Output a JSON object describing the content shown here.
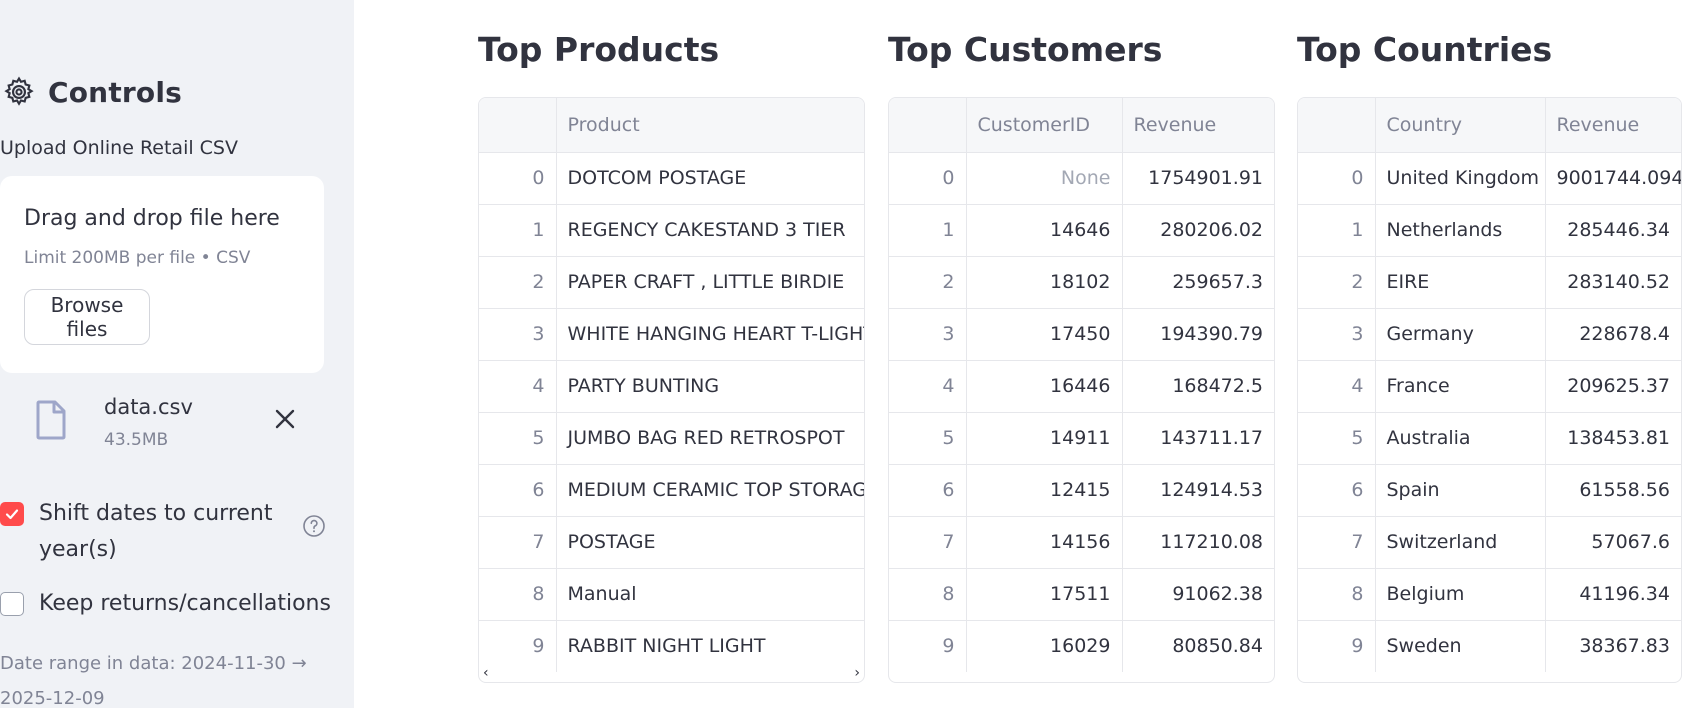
{
  "sidebar": {
    "title": "Controls",
    "upload_label": "Upload Online Retail CSV",
    "dropzone": {
      "title": "Drag and drop file here",
      "limit": "Limit 200MB per file • CSV",
      "browse_label": "Browse files"
    },
    "file": {
      "name": "data.csv",
      "size": "43.5MB"
    },
    "shift_dates": {
      "label": "Shift dates to current year(s)",
      "checked": true
    },
    "keep_returns": {
      "label": "Keep returns/cancellations",
      "checked": false
    },
    "date_range": "Date range in data: 2024-11-30 → 2025-12-09"
  },
  "colors": {
    "accent": "#ff4b4b",
    "sidebar_bg": "#f0f2f6"
  },
  "products": {
    "title": "Top Products",
    "columns": [
      "",
      "Product"
    ],
    "rows": [
      [
        "0",
        "DOTCOM POSTAGE"
      ],
      [
        "1",
        "REGENCY CAKESTAND 3 TIER"
      ],
      [
        "2",
        "PAPER CRAFT , LITTLE BIRDIE"
      ],
      [
        "3",
        "WHITE HANGING HEART T-LIGHT H"
      ],
      [
        "4",
        "PARTY BUNTING"
      ],
      [
        "5",
        "JUMBO BAG RED RETROSPOT"
      ],
      [
        "6",
        "MEDIUM CERAMIC TOP STORAGE J"
      ],
      [
        "7",
        "POSTAGE"
      ],
      [
        "8",
        "Manual"
      ],
      [
        "9",
        "RABBIT NIGHT LIGHT"
      ]
    ],
    "scroll_left": "‹",
    "scroll_right": "›"
  },
  "customers": {
    "title": "Top Customers",
    "columns": [
      "",
      "CustomerID",
      "Revenue"
    ],
    "rows": [
      [
        "0",
        "None",
        "1754901.91"
      ],
      [
        "1",
        "14646",
        "280206.02"
      ],
      [
        "2",
        "18102",
        "259657.3"
      ],
      [
        "3",
        "17450",
        "194390.79"
      ],
      [
        "4",
        "16446",
        "168472.5"
      ],
      [
        "5",
        "14911",
        "143711.17"
      ],
      [
        "6",
        "12415",
        "124914.53"
      ],
      [
        "7",
        "14156",
        "117210.08"
      ],
      [
        "8",
        "17511",
        "91062.38"
      ],
      [
        "9",
        "16029",
        "80850.84"
      ]
    ]
  },
  "countries": {
    "title": "Top Countries",
    "columns": [
      "",
      "Country",
      "Revenue"
    ],
    "rows": [
      [
        "0",
        "United Kingdom",
        "9001744.094"
      ],
      [
        "1",
        "Netherlands",
        "285446.34"
      ],
      [
        "2",
        "EIRE",
        "283140.52"
      ],
      [
        "3",
        "Germany",
        "228678.4"
      ],
      [
        "4",
        "France",
        "209625.37"
      ],
      [
        "5",
        "Australia",
        "138453.81"
      ],
      [
        "6",
        "Spain",
        "61558.56"
      ],
      [
        "7",
        "Switzerland",
        "57067.6"
      ],
      [
        "8",
        "Belgium",
        "41196.34"
      ],
      [
        "9",
        "Sweden",
        "38367.83"
      ]
    ]
  }
}
